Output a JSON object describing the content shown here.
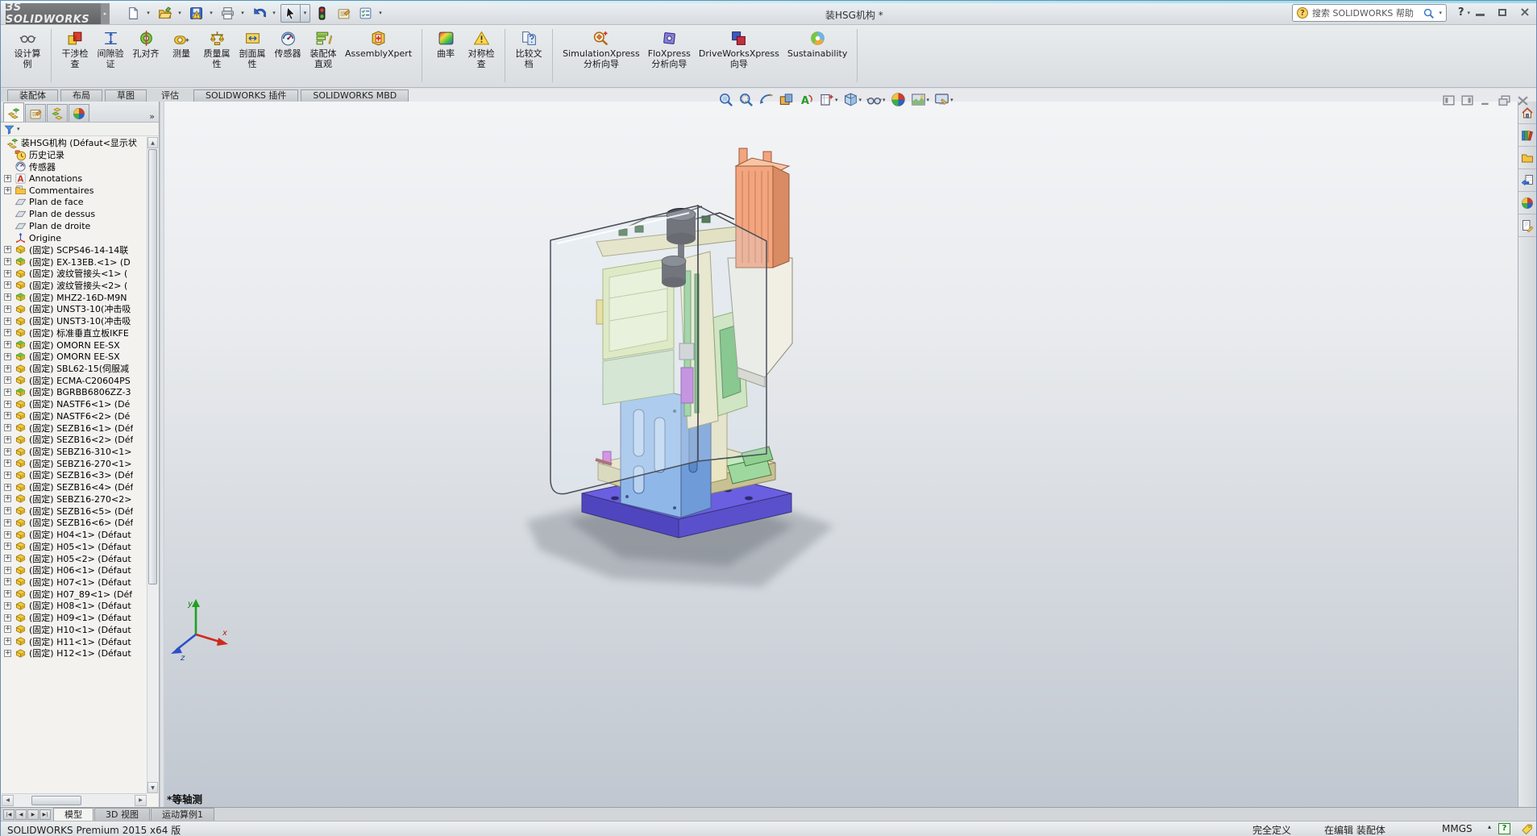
{
  "titlebar": {
    "logo": "ЗS SOLIDWORKS",
    "title": "装HSG机构 *",
    "search_placeholder": "搜索 SOLIDWORKS 帮助",
    "help_label": "?",
    "quick_tools": [
      {
        "name": "new",
        "icon": "page",
        "dd": true
      },
      {
        "name": "open",
        "icon": "folder",
        "dd": true
      },
      {
        "name": "save",
        "icon": "save",
        "dd": true
      },
      {
        "name": "print",
        "icon": "print",
        "dd": true
      },
      {
        "name": "undo",
        "icon": "undo",
        "dd": true
      },
      {
        "name": "select",
        "icon": "cursor",
        "dd": true,
        "boxed": true
      },
      {
        "name": "rebuild",
        "icon": "traffic",
        "dd": false
      },
      {
        "name": "file-properties",
        "icon": "props",
        "dd": false
      },
      {
        "name": "options",
        "icon": "options",
        "dd": true
      }
    ]
  },
  "ribbon": {
    "groups": [
      {
        "buttons": [
          {
            "label": "设计算\n例",
            "icon": "design-study",
            "name": "design-study"
          }
        ]
      },
      {
        "buttons": [
          {
            "label": "干涉检\n查",
            "icon": "interference",
            "name": "interference-check"
          },
          {
            "label": "间隙验\n证",
            "icon": "clearance",
            "name": "clearance-verify"
          },
          {
            "label": "孔对齐",
            "icon": "hole-align",
            "name": "hole-alignment"
          },
          {
            "label": "测量",
            "icon": "measure",
            "name": "measure"
          },
          {
            "label": "质量属\n性",
            "icon": "mass",
            "name": "mass-properties"
          },
          {
            "label": "剖面属\n性",
            "icon": "section",
            "name": "section-properties"
          },
          {
            "label": "传感器",
            "icon": "sensor",
            "name": "sensors"
          },
          {
            "label": "装配体\n直观",
            "icon": "asmvis",
            "name": "assembly-visualization"
          },
          {
            "label": "AssemblyXpert",
            "icon": "axpert",
            "name": "assemblyxpert"
          }
        ]
      },
      {
        "buttons": [
          {
            "label": "曲率",
            "icon": "curvature",
            "name": "curvature"
          },
          {
            "label": "对称检\n查",
            "icon": "symmetry",
            "name": "symmetry-check"
          }
        ]
      },
      {
        "buttons": [
          {
            "label": "比较文\n档",
            "icon": "compare",
            "name": "compare-documents"
          }
        ]
      },
      {
        "buttons": [
          {
            "label": "SimulationXpress\n分析向导",
            "icon": "simx",
            "name": "simulationxpress-wizard"
          },
          {
            "label": "FloXpress\n分析向导",
            "icon": "flox",
            "name": "floxpress-wizard"
          },
          {
            "label": "DriveWorksXpress\n向导",
            "icon": "dwx",
            "name": "driveworksxpress-wizard"
          },
          {
            "label": "Sustainability",
            "icon": "sustain",
            "name": "sustainability"
          }
        ]
      }
    ]
  },
  "command_tabs": [
    {
      "label": "装配体"
    },
    {
      "label": "布局"
    },
    {
      "label": "草图"
    },
    {
      "label": "评估",
      "active": true
    },
    {
      "label": "SOLIDWORKS 插件"
    },
    {
      "label": "SOLIDWORKS MBD"
    }
  ],
  "panel_tabs": [
    {
      "name": "featuremanager",
      "icon": "ptree",
      "active": true
    },
    {
      "name": "propertymanager",
      "icon": "pprops"
    },
    {
      "name": "configurationmanager",
      "icon": "pconfig"
    },
    {
      "name": "displaymanager",
      "icon": "pdisplay"
    }
  ],
  "panel_more": "»",
  "filter_dd": "▾",
  "feature_tree": {
    "rows": [
      {
        "label": "装HSG机构 (Défaut<显示状",
        "icon": "asm-root",
        "expand": false,
        "root": true
      },
      {
        "label": "历史记录",
        "icon": "history",
        "expand": false
      },
      {
        "label": "传感器",
        "icon": "gauge",
        "expand": false
      },
      {
        "label": "Annotations",
        "icon": "annA",
        "expand": true
      },
      {
        "label": "Commentaires",
        "icon": "comments",
        "expand": true
      },
      {
        "label": "Plan de face",
        "icon": "plane",
        "expand": false
      },
      {
        "label": "Plan de dessus",
        "icon": "plane",
        "expand": false
      },
      {
        "label": "Plan de droite",
        "icon": "plane",
        "expand": false
      },
      {
        "label": "Origine",
        "icon": "origin",
        "expand": false
      },
      {
        "label": "(固定) SCPS46-14-14联",
        "icon": "part",
        "expand": true
      },
      {
        "label": "(固定) EX-13EB.<1> (D",
        "icon": "part-green",
        "expand": true
      },
      {
        "label": "(固定) 波纹管接头<1> (",
        "icon": "part",
        "expand": true
      },
      {
        "label": "(固定) 波纹管接头<2> (",
        "icon": "part",
        "expand": true
      },
      {
        "label": "(固定) MHZ2-16D-M9N",
        "icon": "part-green",
        "expand": true
      },
      {
        "label": "(固定) UNST3-10(冲击吸",
        "icon": "part",
        "expand": true
      },
      {
        "label": "(固定) UNST3-10(冲击吸",
        "icon": "part",
        "expand": true
      },
      {
        "label": "(固定) 标准垂直立板IKFE",
        "icon": "part",
        "expand": true
      },
      {
        "label": "(固定) OMORN EE-SX",
        "icon": "part-green",
        "expand": true
      },
      {
        "label": "(固定) OMORN EE-SX",
        "icon": "part-green",
        "expand": true
      },
      {
        "label": "(固定) SBL62-15(伺服减",
        "icon": "part",
        "expand": true
      },
      {
        "label": "(固定) ECMA-C20604PS",
        "icon": "part",
        "expand": true
      },
      {
        "label": "(固定) BGRBB6806ZZ-3",
        "icon": "part-green",
        "expand": true
      },
      {
        "label": "(固定) NASTF6<1> (Dé",
        "icon": "part",
        "expand": true
      },
      {
        "label": "(固定) NASTF6<2> (Dé",
        "icon": "part",
        "expand": true
      },
      {
        "label": "(固定) SEZB16<1> (Déf",
        "icon": "part",
        "expand": true
      },
      {
        "label": "(固定) SEZB16<2> (Déf",
        "icon": "part",
        "expand": true
      },
      {
        "label": "(固定) SEBZ16-310<1>",
        "icon": "part",
        "expand": true
      },
      {
        "label": "(固定) SEBZ16-270<1>",
        "icon": "part",
        "expand": true
      },
      {
        "label": "(固定) SEZB16<3> (Déf",
        "icon": "part",
        "expand": true
      },
      {
        "label": "(固定) SEZB16<4> (Déf",
        "icon": "part",
        "expand": true
      },
      {
        "label": "(固定) SEBZ16-270<2>",
        "icon": "part",
        "expand": true
      },
      {
        "label": "(固定) SEZB16<5> (Déf",
        "icon": "part",
        "expand": true
      },
      {
        "label": "(固定) SEZB16<6> (Déf",
        "icon": "part",
        "expand": true
      },
      {
        "label": "(固定) H04<1> (Défaut",
        "icon": "part",
        "expand": true
      },
      {
        "label": "(固定) H05<1> (Défaut",
        "icon": "part",
        "expand": true
      },
      {
        "label": "(固定) H05<2> (Défaut",
        "icon": "part",
        "expand": true
      },
      {
        "label": "(固定) H06<1> (Défaut",
        "icon": "part",
        "expand": true
      },
      {
        "label": "(固定) H07<1> (Défaut",
        "icon": "part",
        "expand": true
      },
      {
        "label": "(固定) H07_89<1> (Déf",
        "icon": "part",
        "expand": true
      },
      {
        "label": "(固定) H08<1> (Défaut",
        "icon": "part",
        "expand": true
      },
      {
        "label": "(固定) H09<1> (Défaut",
        "icon": "part",
        "expand": true
      },
      {
        "label": "(固定) H10<1> (Défaut",
        "icon": "part",
        "expand": true
      },
      {
        "label": "(固定) H11<1> (Défaut",
        "icon": "part",
        "expand": true
      },
      {
        "label": "(固定) H12<1> (Défaut",
        "icon": "part",
        "expand": true
      }
    ]
  },
  "headsup_tools": [
    {
      "name": "zoom-to-fit",
      "icon": "zoomfit",
      "dd": false
    },
    {
      "name": "zoom-to-area",
      "icon": "zoomarea",
      "dd": false
    },
    {
      "name": "previous-view",
      "icon": "prevview",
      "dd": false
    },
    {
      "name": "section-view",
      "icon": "sectionview",
      "dd": false
    },
    {
      "name": "annotation-view",
      "icon": "annoview",
      "dd": false
    },
    {
      "name": "view-orientation",
      "icon": "vieworient",
      "dd": true
    },
    {
      "name": "display-style",
      "icon": "dispstyle",
      "dd": true
    },
    {
      "name": "hide-show-items",
      "icon": "hideshow",
      "dd": true
    },
    {
      "name": "edit-appearance",
      "icon": "ball",
      "dd": false
    },
    {
      "name": "apply-scene",
      "icon": "scene",
      "dd": true
    },
    {
      "name": "view-settings",
      "icon": "viewset",
      "dd": true
    }
  ],
  "doc_window_buttons": [
    {
      "name": "show-left-pane",
      "icon": "panes1"
    },
    {
      "name": "show-right-pane",
      "icon": "panes2"
    },
    {
      "name": "minimize-document",
      "icon": "dmin"
    },
    {
      "name": "restore-document",
      "icon": "dcascade"
    },
    {
      "name": "close-document",
      "icon": "dclose"
    }
  ],
  "viewport": {
    "view_label": "*等轴测",
    "axis_labels": {
      "x": "x",
      "y": "y",
      "z": "z"
    }
  },
  "task_pane": [
    {
      "name": "solidworks-resources",
      "icon": "home"
    },
    {
      "name": "design-library",
      "icon": "library"
    },
    {
      "name": "file-explorer",
      "icon": "folderplain"
    },
    {
      "name": "view-palette",
      "icon": "palette"
    },
    {
      "name": "appearances-scenes",
      "icon": "ball"
    },
    {
      "name": "custom-properties",
      "icon": "pagepencil"
    }
  ],
  "doc_tabs": {
    "nav": [
      "|◀",
      "◀",
      "▶",
      "▶|"
    ],
    "tabs": [
      {
        "label": "模型",
        "active": true
      },
      {
        "label": "3D 视图"
      },
      {
        "label": "运动算例1"
      }
    ]
  },
  "status_bar": {
    "product": "SOLIDWORKS Premium 2015 x64 版",
    "define_state": "完全定义",
    "edit_state": "在编辑 装配体",
    "units": "MMGS"
  },
  "colors": {
    "base_plate": "#6a5fe0",
    "column_blue": "#8fb8e8",
    "fixture_yellow": "#dce8a8",
    "actuator_orange": "#f2a57f",
    "base_cream": "#eae3b8"
  }
}
